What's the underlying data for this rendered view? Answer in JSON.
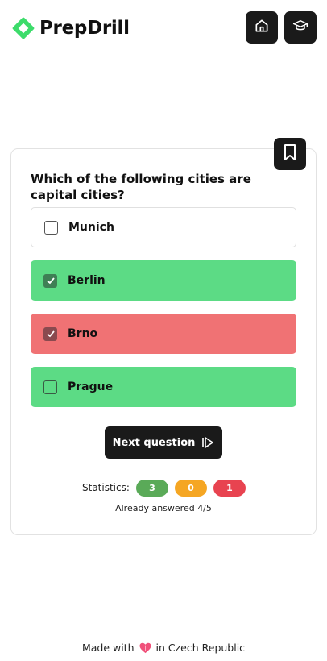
{
  "header": {
    "brand": "PrepDrill",
    "home_icon": "home-icon",
    "learn_icon": "graduation-cap-icon"
  },
  "quiz": {
    "question": "Which of the following cities are capital cities?",
    "options": [
      {
        "label": "Munich",
        "checked": false,
        "state": "neutral"
      },
      {
        "label": "Berlin",
        "checked": true,
        "state": "correct"
      },
      {
        "label": "Brno",
        "checked": true,
        "state": "wrong"
      },
      {
        "label": "Prague",
        "checked": false,
        "state": "correct"
      }
    ],
    "next_label": "Next question",
    "bookmark_icon": "bookmark-icon"
  },
  "stats": {
    "label": "Statistics:",
    "correct": "3",
    "partial": "0",
    "wrong": "1",
    "answered": "Already answered 4/5"
  },
  "footer": {
    "before": "Made with",
    "after": "in Czech Republic"
  },
  "colors": {
    "correct": "#5cdb85",
    "wrong": "#f07274",
    "brand": "#3ddc6b",
    "dark": "#1a1a1a"
  }
}
